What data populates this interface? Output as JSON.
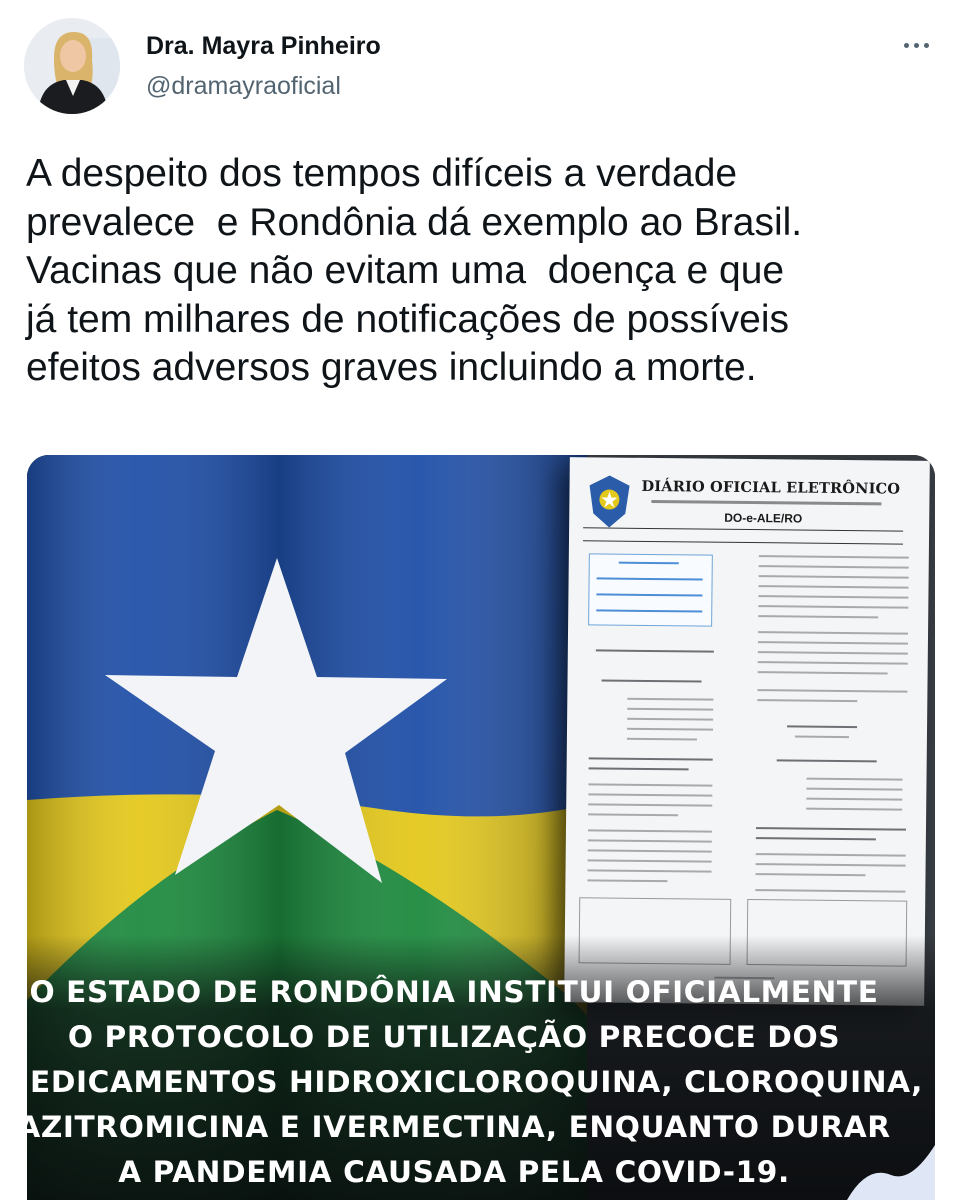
{
  "author": {
    "display_name": "Dra. Mayra Pinheiro",
    "handle": "@dramayraoficial"
  },
  "icons": {
    "more": "more-horizontal-icon",
    "avatar": "profile-photo"
  },
  "tweet": {
    "text_lines": [
      "A despeito dos tempos difíceis a verdade",
      "prevalece  e Rondônia dá exemplo ao Brasil.",
      "Vacinas que não evitam uma  doença e que",
      "já tem milhares de notificações de possíveis",
      "efeitos adversos graves incluindo a morte."
    ]
  },
  "media": {
    "document_title": "DIÁRIO OFICIAL ELETRÔNICO",
    "document_code": "DO-e-ALE/RO",
    "banner_lines": [
      "O ESTADO DE RONDÔNIA INSTITUI OFICIALMENTE",
      "O PROTOCOLO DE UTILIZAÇÃO PRECOCE DOS",
      "MEDICAMENTOS HIDROXICLOROQUINA, CLOROQUINA,",
      "AZITROMICINA E IVERMECTINA, ENQUANTO DURAR",
      "A PANDEMIA CAUSADA PELA COVID-19."
    ],
    "colors": {
      "flag_blue": "#1f4fa8",
      "flag_yellow": "#e4c81b",
      "flag_green": "#1d8a3e",
      "star": "#ffffff"
    }
  }
}
